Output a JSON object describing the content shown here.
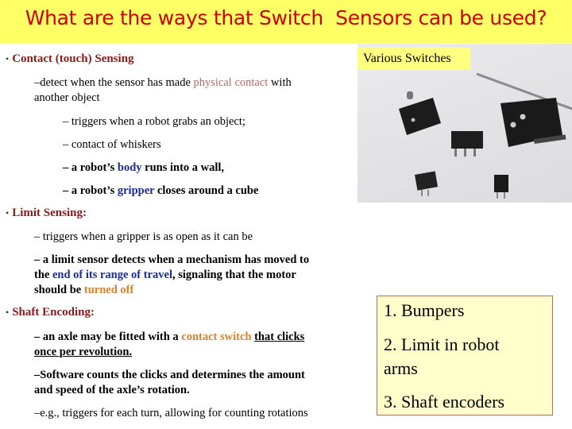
{
  "title": "What are the ways that Switch  Sensors can be used?",
  "photo": {
    "label": "Various Switches",
    "description": "photo of assorted microswitches"
  },
  "sections": [
    {
      "heading": "Contact (touch) Sensing",
      "lines": [
        {
          "parts": [
            "–detect when the sensor has made ",
            "physical contact",
            "  with"
          ]
        },
        {
          "text": "another object"
        },
        {
          "text": "– triggers when a robot grabs an object;"
        },
        {
          "text": "– contact of whiskers"
        },
        {
          "parts": [
            "– a robot’s ",
            "body",
            " runs into a wall,"
          ]
        },
        {
          "parts": [
            "– a robot’s ",
            "gripper",
            " closes around a cube"
          ]
        }
      ]
    },
    {
      "heading": "Limit Sensing:",
      "lines": [
        {
          "text": "– triggers when a gripper is as open as it can be"
        },
        {
          "text": "– a limit sensor detects when a mechanism has moved to"
        },
        {
          "parts": [
            "the ",
            "end of its range of travel",
            ", signaling that the motor"
          ]
        },
        {
          "parts": [
            "should be ",
            "turned off"
          ]
        }
      ]
    },
    {
      "heading": "Shaft Encoding:",
      "lines": [
        {
          "parts": [
            "– an axle may be fitted with a ",
            "contact switch",
            " ",
            "that clicks"
          ]
        },
        {
          "text": "once per revolution."
        },
        {
          "text": "–Software counts the clicks and determines the amount"
        },
        {
          "text": "and speed of the axle’s rotation."
        },
        {
          "text": "–e.g., triggers for each turn, allowing for counting rotations"
        }
      ]
    }
  ],
  "uses_box": {
    "items": [
      "1. Bumpers",
      "2. Limit in robot",
      "arms",
      "3. Shaft encoders"
    ]
  }
}
